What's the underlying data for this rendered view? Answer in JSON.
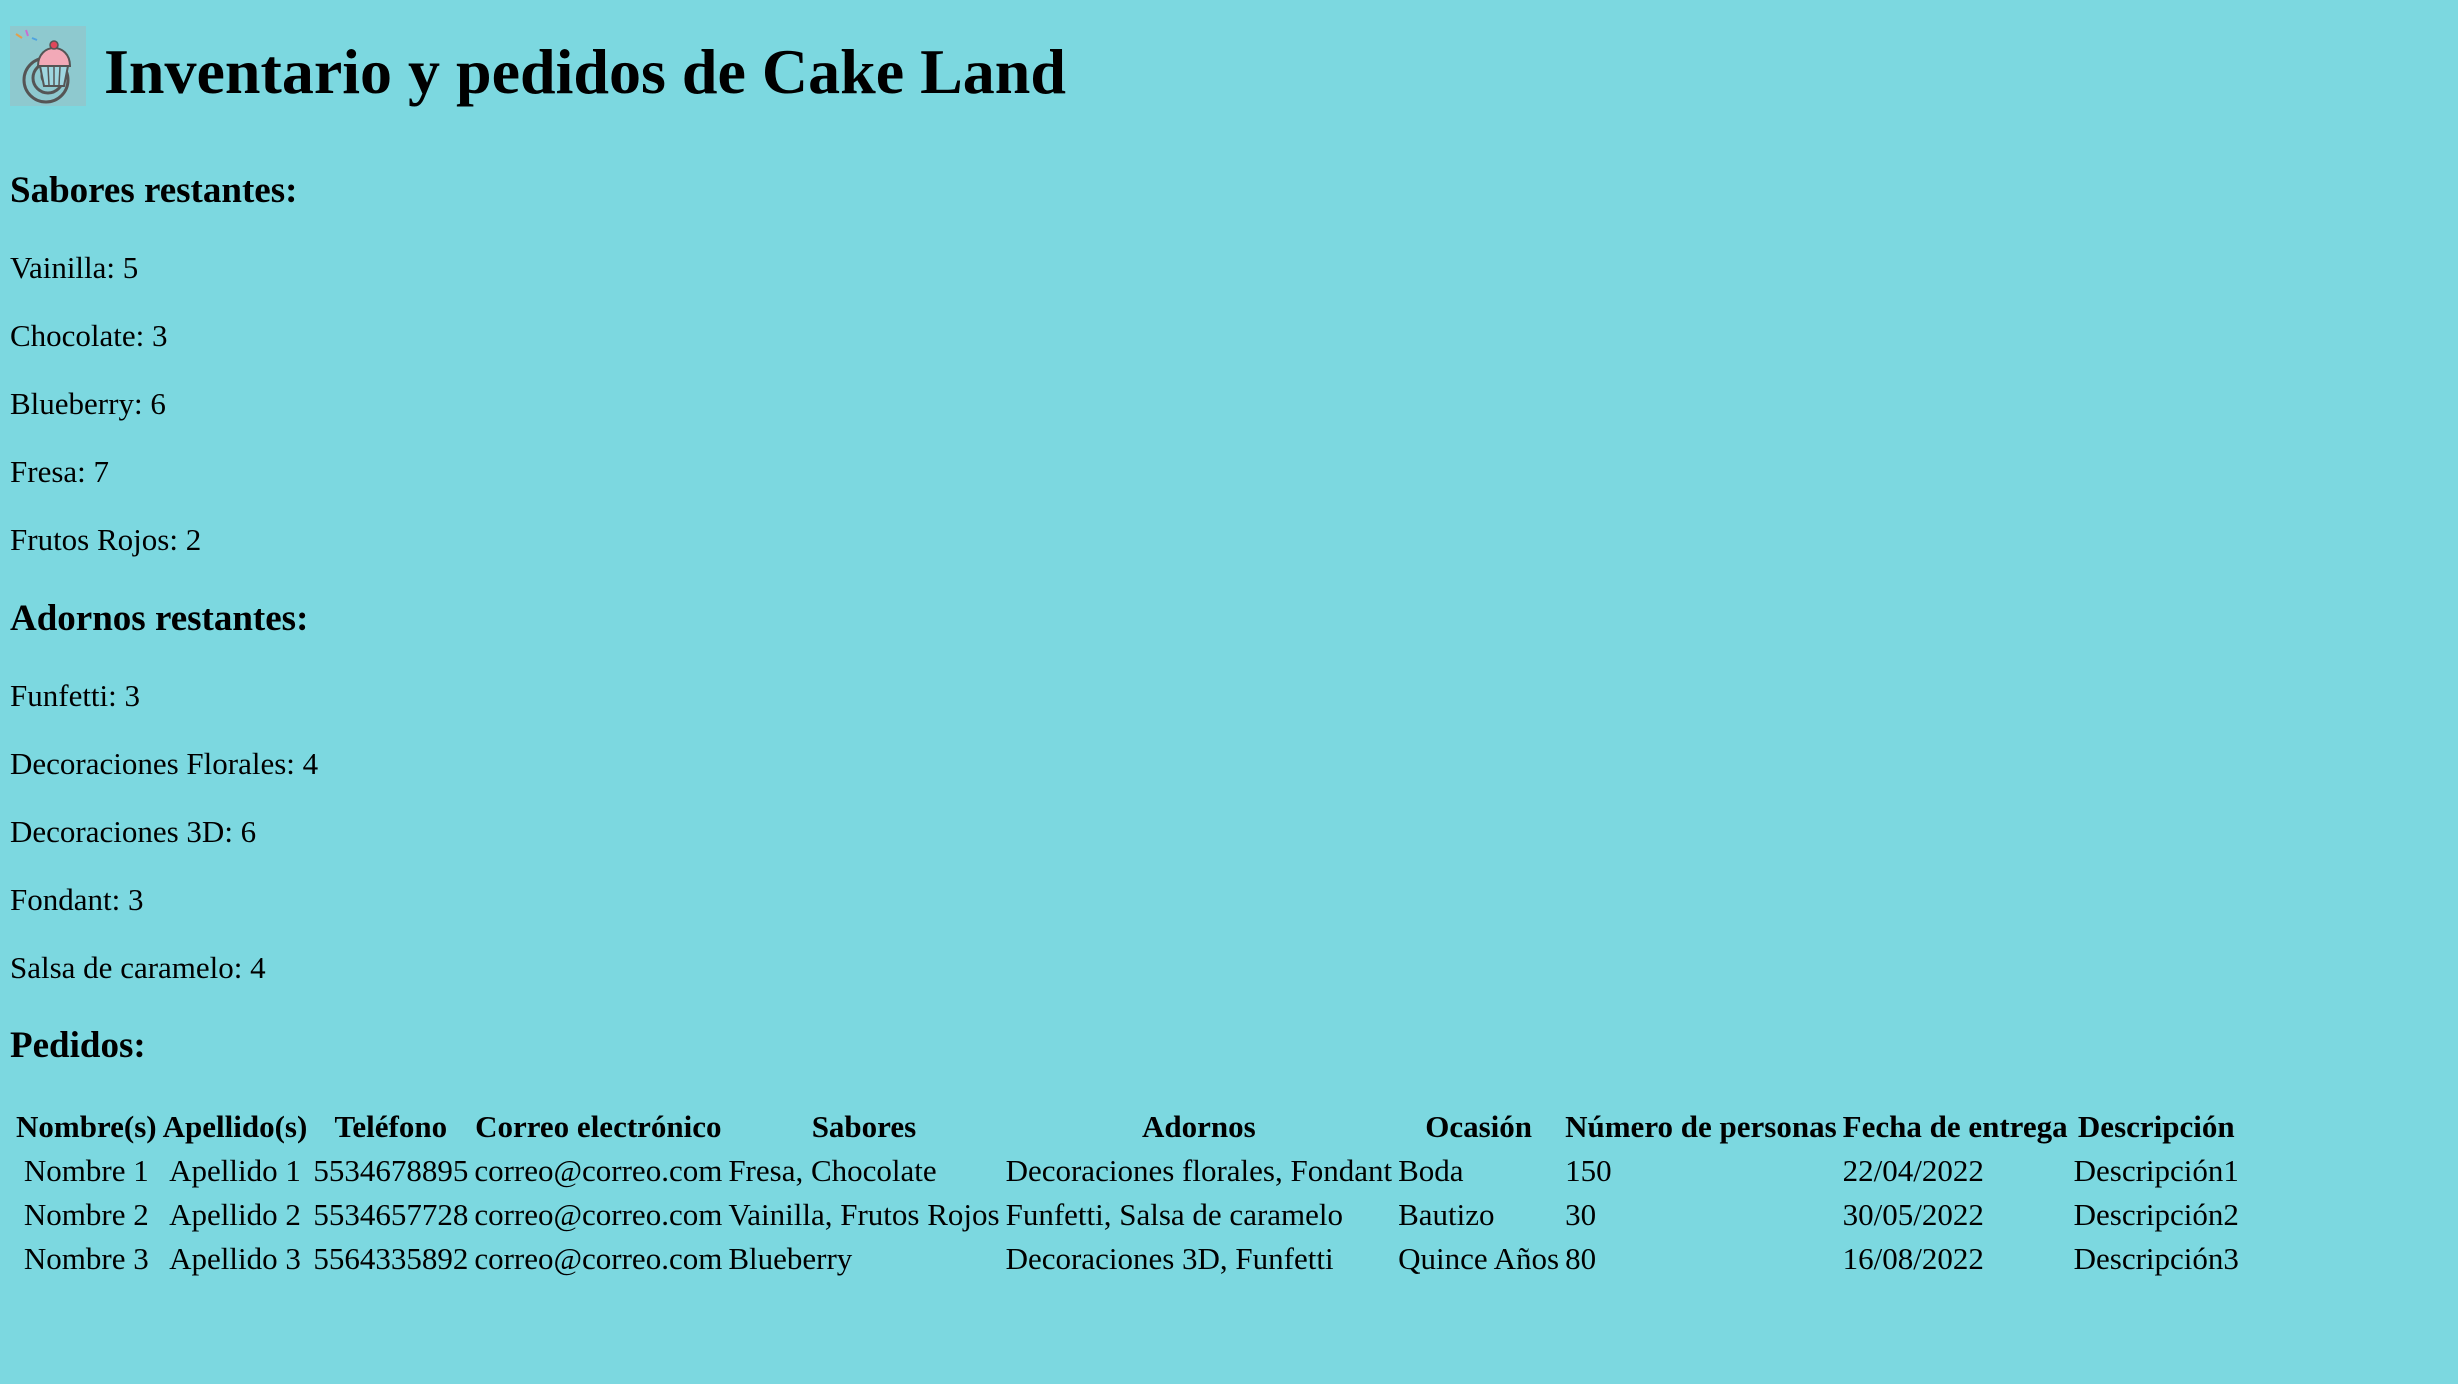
{
  "header": {
    "title": "Inventario y pedidos de Cake Land",
    "logo_icon": "cupcake-logo-icon"
  },
  "flavors": {
    "heading": "Sabores restantes:",
    "items": [
      "Vainilla: 5",
      "Chocolate: 3",
      "Blueberry: 6",
      "Fresa: 7",
      "Frutos Rojos: 2"
    ]
  },
  "decorations": {
    "heading": "Adornos restantes:",
    "items": [
      "Funfetti: 3",
      "Decoraciones Florales: 4",
      "Decoraciones 3D: 6",
      "Fondant: 3",
      "Salsa de caramelo: 4"
    ]
  },
  "orders": {
    "heading": "Pedidos:",
    "columns": [
      "Nombre(s)",
      "Apellido(s)",
      "Teléfono",
      "Correo electrónico",
      "Sabores",
      "Adornos",
      "Ocasión",
      "Número de personas",
      "Fecha de entrega",
      "Descripción"
    ],
    "rows": [
      [
        "Nombre 1",
        "Apellido 1",
        "5534678895",
        "correo@correo.com",
        "Fresa, Chocolate",
        "Decoraciones florales, Fondant",
        "Boda",
        "150",
        "22/04/2022",
        "Descripción1"
      ],
      [
        "Nombre 2",
        "Apellido 2",
        "5534657728",
        "correo@correo.com",
        "Vainilla, Frutos Rojos",
        "Funfetti, Salsa de caramelo",
        "Bautizo",
        "30",
        "30/05/2022",
        "Descripción2"
      ],
      [
        "Nombre 3",
        "Apellido 3",
        "5564335892",
        "correo@correo.com",
        "Blueberry",
        "Decoraciones 3D, Funfetti",
        "Quince Años",
        "80",
        "16/08/2022",
        "Descripción3"
      ]
    ]
  },
  "colors": {
    "background": "#7cd8e0",
    "text": "#000000"
  }
}
